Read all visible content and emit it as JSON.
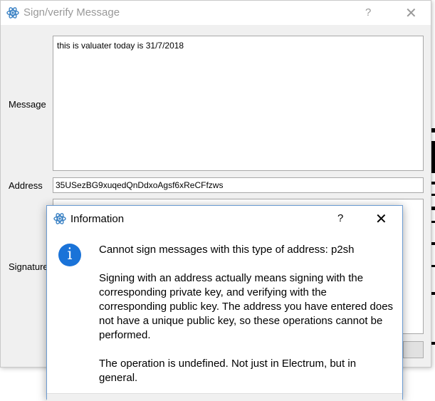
{
  "background_dialog": {
    "title": "Sign/verify Message",
    "help_label": "?",
    "close_label": "✕",
    "message_label": "Message",
    "message_value": "this is valuater today is 31/7/2018",
    "address_label": "Address",
    "address_value": "35USezBG9xuqedQnDdxoAgsf6xReCFfzws",
    "signature_label": "Signature"
  },
  "info_dialog": {
    "title": "Information",
    "help_label": "?",
    "close_label": "✕",
    "icon_glyph": "i",
    "line1": "Cannot sign messages with this type of address: p2sh",
    "line2": "Signing with an address actually means signing with the corresponding private key, and verifying with the corresponding public key. The address you have entered does not have a unique public key, so these operations cannot be performed.",
    "line3": "The operation is undefined. Not just in Electrum, but in general."
  },
  "icons": {
    "app_icon": "electrum-atom-icon",
    "info_icon": "info-icon"
  },
  "colors": {
    "accent": "#1a73d8",
    "app_icon_blue": "#3b82c4"
  }
}
